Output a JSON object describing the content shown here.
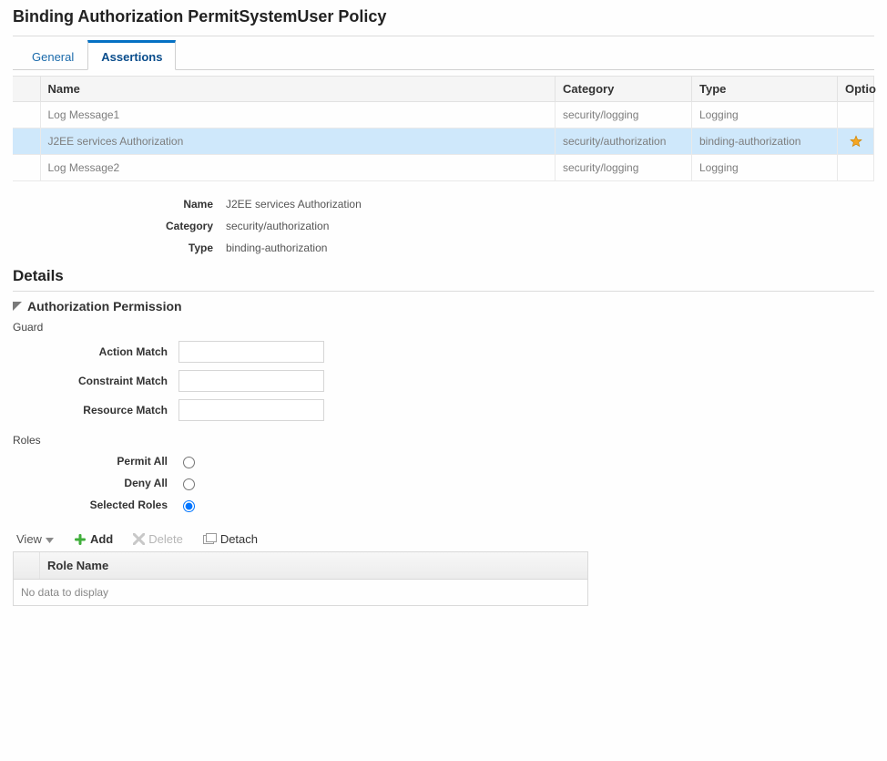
{
  "header": {
    "title": "Binding Authorization PermitSystemUser Policy"
  },
  "tabs": {
    "general": "General",
    "assertions": "Assertions"
  },
  "assertions_table": {
    "columns": {
      "name": "Name",
      "category": "Category",
      "type": "Type",
      "options": "Optio"
    },
    "rows": [
      {
        "name": "Log Message1",
        "category": "security/logging",
        "type": "Logging",
        "starred": false,
        "selected": false
      },
      {
        "name": "J2EE services Authorization",
        "category": "security/authorization",
        "type": "binding-authorization",
        "starred": true,
        "selected": true
      },
      {
        "name": "Log Message2",
        "category": "security/logging",
        "type": "Logging",
        "starred": false,
        "selected": false
      }
    ]
  },
  "summary": {
    "name_label": "Name",
    "name_value": "J2EE services Authorization",
    "category_label": "Category",
    "category_value": "security/authorization",
    "type_label": "Type",
    "type_value": "binding-authorization"
  },
  "details": {
    "heading": "Details",
    "auth_perm_heading": "Authorization Permission",
    "guard": {
      "heading": "Guard",
      "action_match_label": "Action Match",
      "action_match_value": "",
      "constraint_match_label": "Constraint Match",
      "constraint_match_value": "",
      "resource_match_label": "Resource Match",
      "resource_match_value": ""
    },
    "roles": {
      "heading": "Roles",
      "permit_all_label": "Permit All",
      "deny_all_label": "Deny All",
      "selected_roles_label": "Selected Roles",
      "selected_option": "selected_roles"
    },
    "toolbar": {
      "view_label": "View",
      "add_label": "Add",
      "delete_label": "Delete",
      "detach_label": "Detach"
    },
    "role_table": {
      "column": "Role Name",
      "empty_text": "No data to display"
    }
  }
}
